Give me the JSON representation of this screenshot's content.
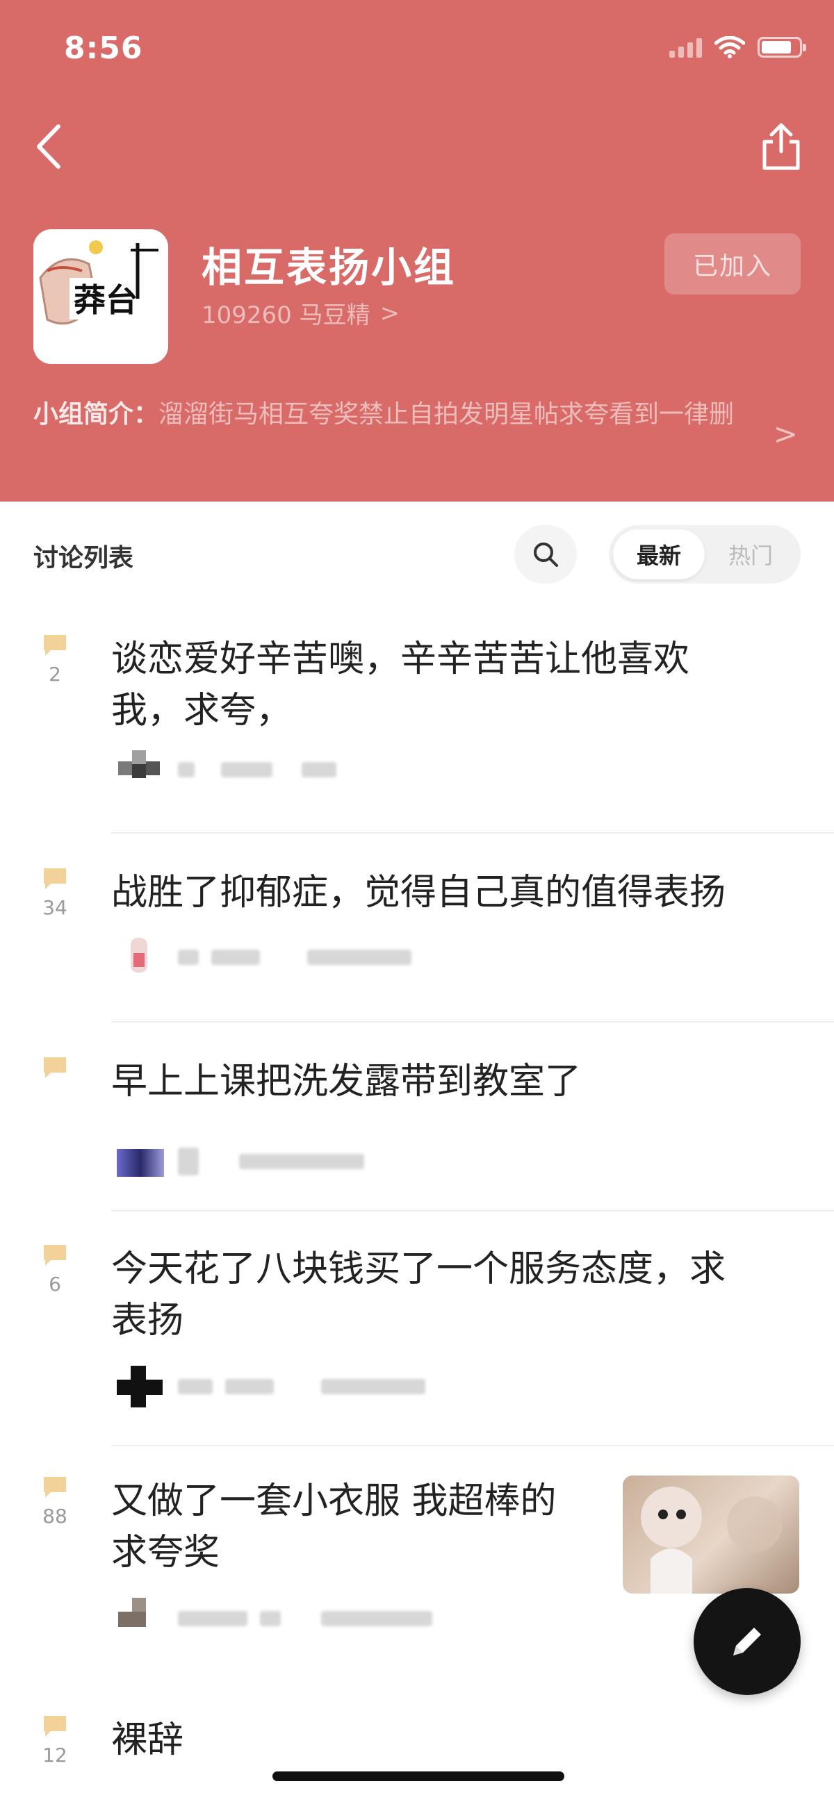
{
  "status_bar": {
    "time": "8:56"
  },
  "group": {
    "name": "相互表扬小组",
    "members": "109260 马豆精",
    "member_chevron": ">",
    "join_button": "已加入",
    "intro_label": "小组简介：",
    "intro_text": "溜溜街马相互夸奖禁止自拍发明星帖求夸看到一律删",
    "intro_chevron": ">"
  },
  "list": {
    "title": "讨论列表",
    "sort_options": [
      "最新",
      "热门"
    ]
  },
  "posts": [
    {
      "title_lines": [
        "谈恋爱好辛苦噢，辛辛苦苦让他喜欢",
        "我，求夸，"
      ],
      "count": "2"
    },
    {
      "title_lines": [
        "战胜了抑郁症，觉得自己真的值得表扬"
      ],
      "count": "34"
    },
    {
      "title_lines": [
        "早上上课把洗发露带到教室了"
      ],
      "count": ""
    },
    {
      "title_lines": [
        "今天花了八块钱买了一个服务态度，求",
        "表扬"
      ],
      "count": "6"
    },
    {
      "title_lines": [
        "又做了一套小衣服 我超棒的",
        "求夸奖"
      ],
      "count": "88",
      "has_thumbnail": true
    },
    {
      "title_lines": [
        "裸辞"
      ],
      "count": "12"
    }
  ],
  "icons": {
    "back": "back-arrow-icon",
    "share": "share-icon",
    "search": "search-icon",
    "comment": "comment-bubble-icon",
    "compose": "pencil-icon"
  },
  "colors": {
    "header_bg": "#d86a68",
    "comment_icon": "#f3d29a",
    "fab_bg": "#141414"
  }
}
